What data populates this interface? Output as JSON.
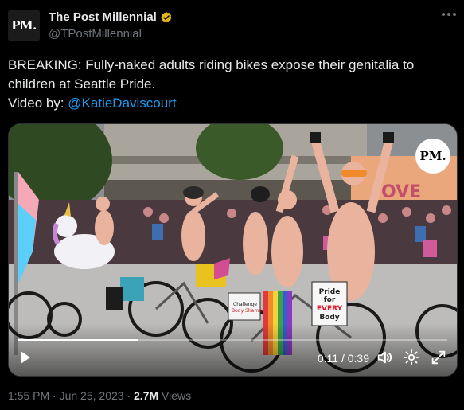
{
  "account": {
    "avatar_text": "PM.",
    "display_name": "The Post Millennial",
    "handle": "@TPostMillennial",
    "verified_icon": "gold-verified-badge-icon"
  },
  "tweet": {
    "line1": "BREAKING: Fully-naked adults riding bikes expose their genitalia to",
    "line2": "children at Seattle Pride.",
    "video_by_prefix": "Video by: ",
    "video_by_link": "@KatieDaviscourt"
  },
  "video": {
    "watermark": "PM.",
    "time": "0:11 / 0:39",
    "progress": 0.28,
    "sign_text": "Pride for EVERY Body",
    "icons": [
      "play-icon",
      "volume-icon",
      "settings-gear-icon",
      "fullscreen-icon"
    ]
  },
  "meta": {
    "time": "1:55 PM",
    "sep1": " · ",
    "date": "Jun 25, 2023",
    "sep2": " · ",
    "views_count": "2.7M",
    "views_label": " Views"
  },
  "colors": {
    "link": "#1d9bf0",
    "secondary_text": "#71767b",
    "verified": "#e2b719"
  }
}
